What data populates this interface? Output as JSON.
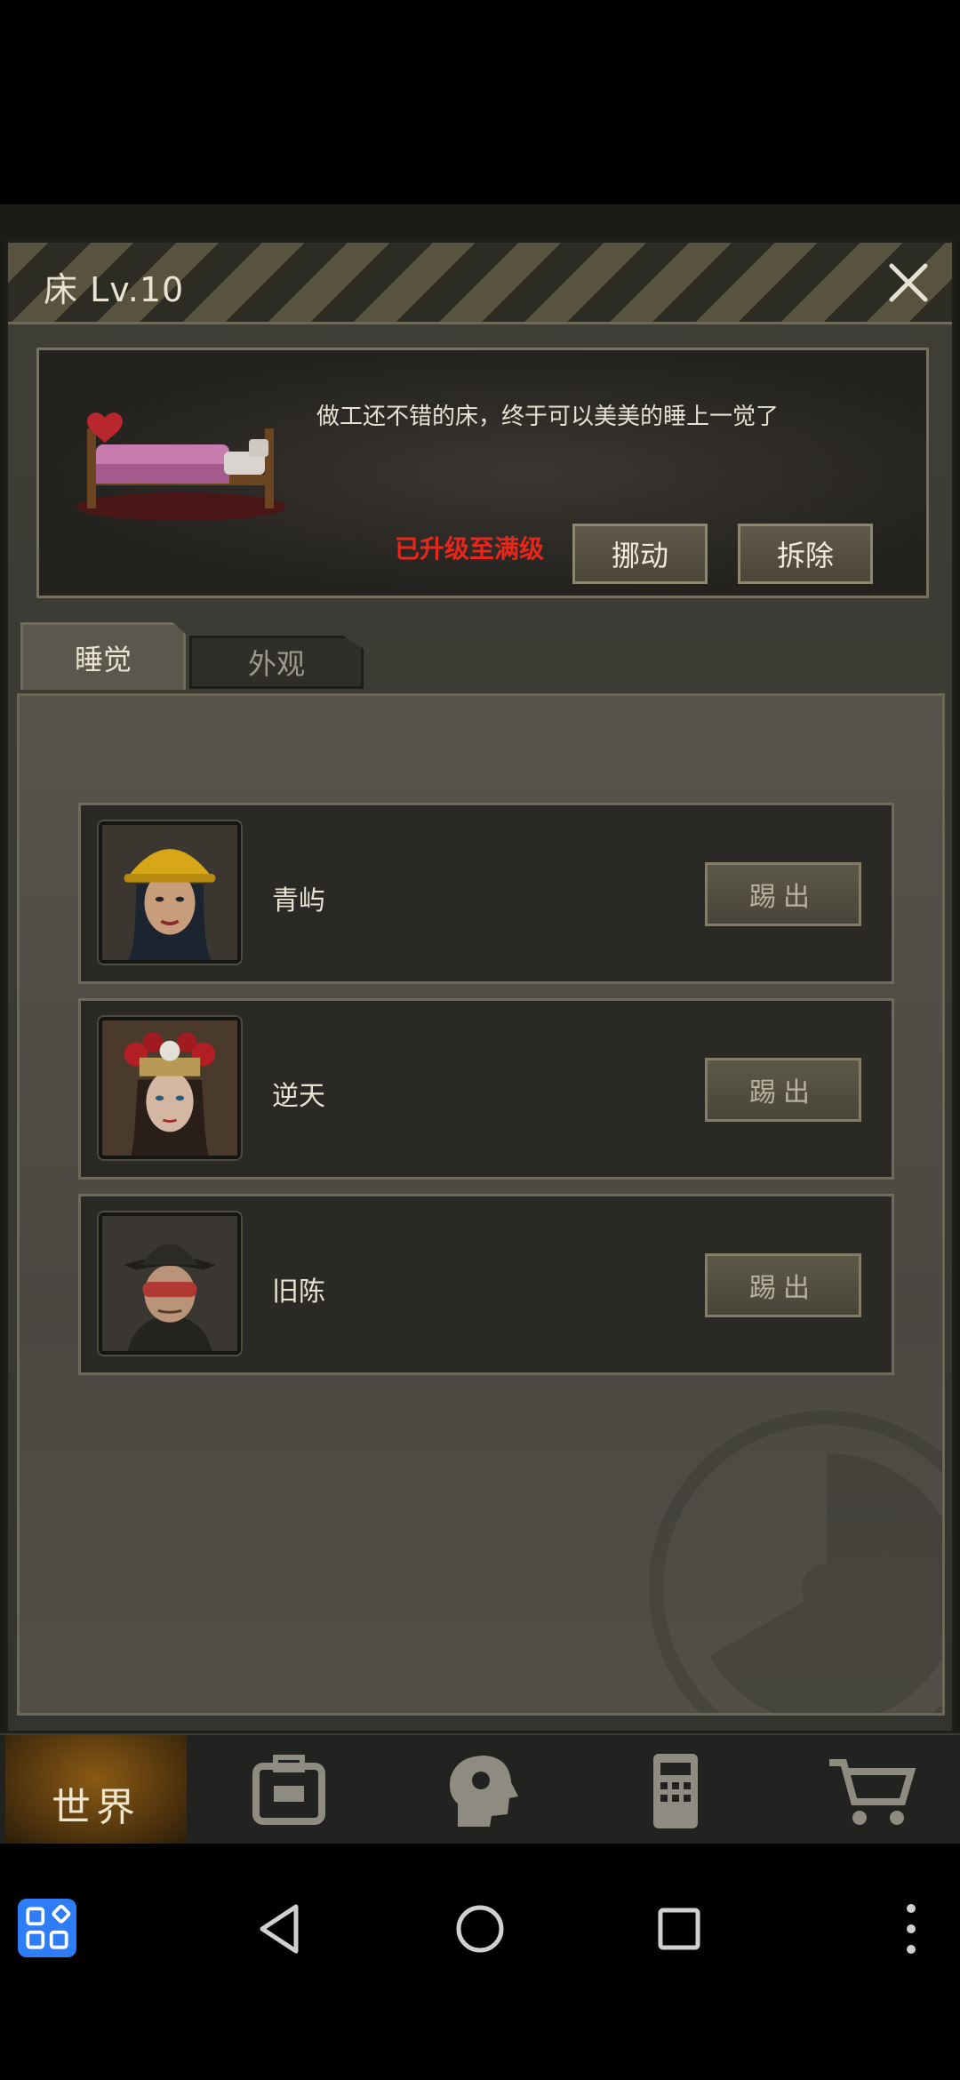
{
  "dialog": {
    "title": "床 Lv.10",
    "description": "做工还不错的床，终于可以美美的睡上一觉了",
    "status": "已升级至满级",
    "buttons": {
      "move": "挪动",
      "demolish": "拆除"
    }
  },
  "tabs": [
    {
      "label": "睡觉",
      "active": true
    },
    {
      "label": "外观",
      "active": false
    }
  ],
  "sleepers": [
    {
      "name": "青屿",
      "kick_label": "踢出",
      "avatar_icon": "hardhat-woman-portrait"
    },
    {
      "name": "逆天",
      "kick_label": "踢出",
      "avatar_icon": "opera-headdress-woman-portrait"
    },
    {
      "name": "旧陈",
      "kick_label": "踢出",
      "avatar_icon": "fedora-goggles-man-portrait"
    }
  ],
  "game_nav": {
    "world_label": "世界",
    "icons": [
      "globe-icon",
      "backpack-icon",
      "head-gear-icon",
      "phone-icon",
      "cart-icon"
    ]
  },
  "colors": {
    "accent_red": "#e8271c",
    "panel_border": "#76725e",
    "android_apps_blue": "#2f7df6"
  }
}
